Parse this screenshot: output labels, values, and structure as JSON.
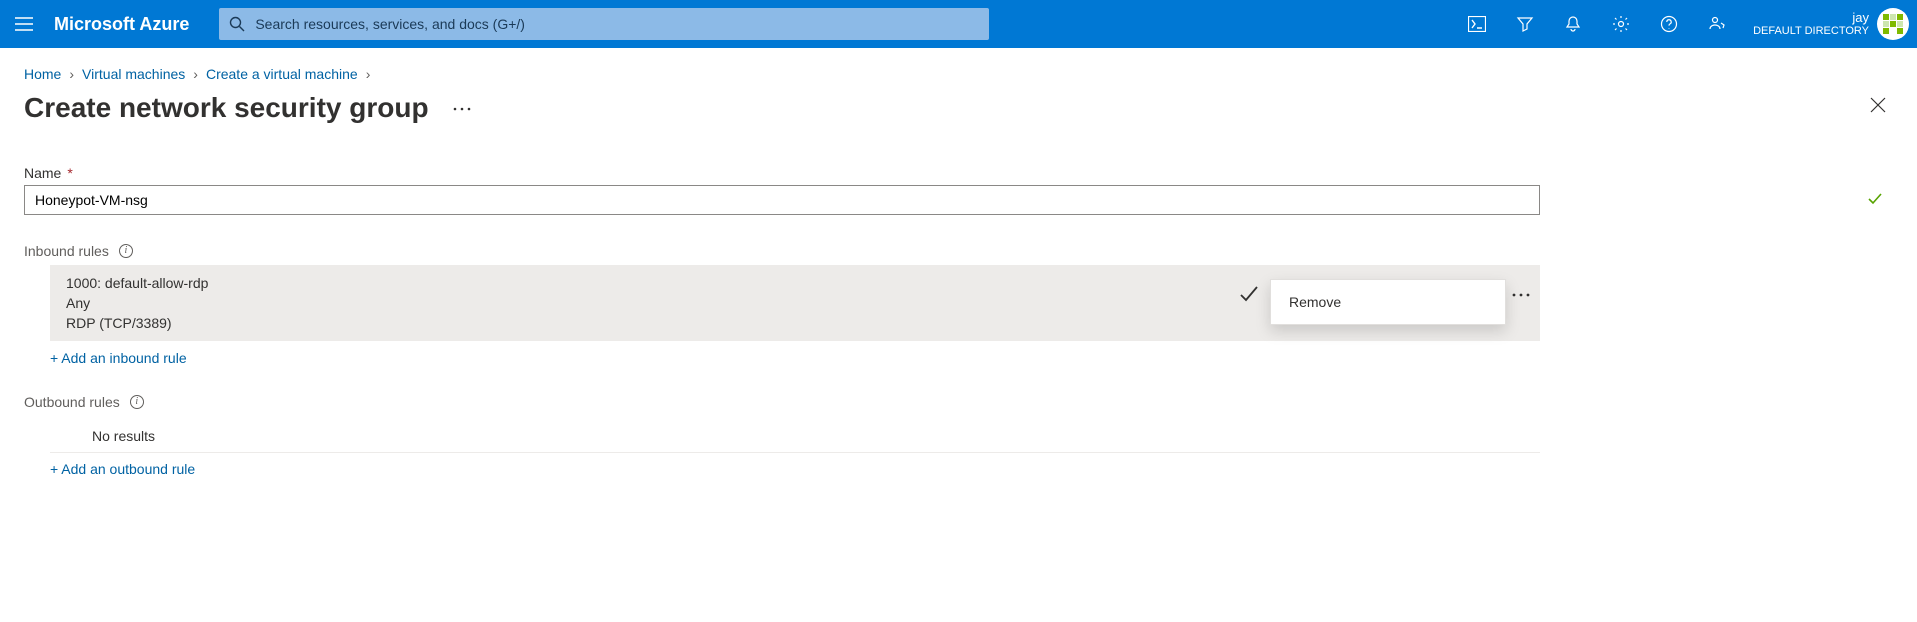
{
  "header": {
    "brand": "Microsoft Azure",
    "search_placeholder": "Search resources, services, and docs (G+/)",
    "user_name": "jay",
    "user_directory": "DEFAULT DIRECTORY"
  },
  "breadcrumb": {
    "items": [
      {
        "label": "Home"
      },
      {
        "label": "Virtual machines"
      },
      {
        "label": "Create a virtual machine"
      }
    ]
  },
  "page": {
    "title": "Create network security group"
  },
  "form": {
    "name_label": "Name",
    "name_value": "Honeypot-VM-nsg"
  },
  "inbound": {
    "section_label": "Inbound rules",
    "rules": [
      {
        "title": "1000: default-allow-rdp",
        "source": "Any",
        "protocol": "RDP (TCP/3389)"
      }
    ],
    "add_label": "+ Add an inbound rule"
  },
  "context_menu": {
    "remove_label": "Remove"
  },
  "outbound": {
    "section_label": "Outbound rules",
    "empty_label": "No results",
    "add_label": "+ Add an outbound rule"
  }
}
